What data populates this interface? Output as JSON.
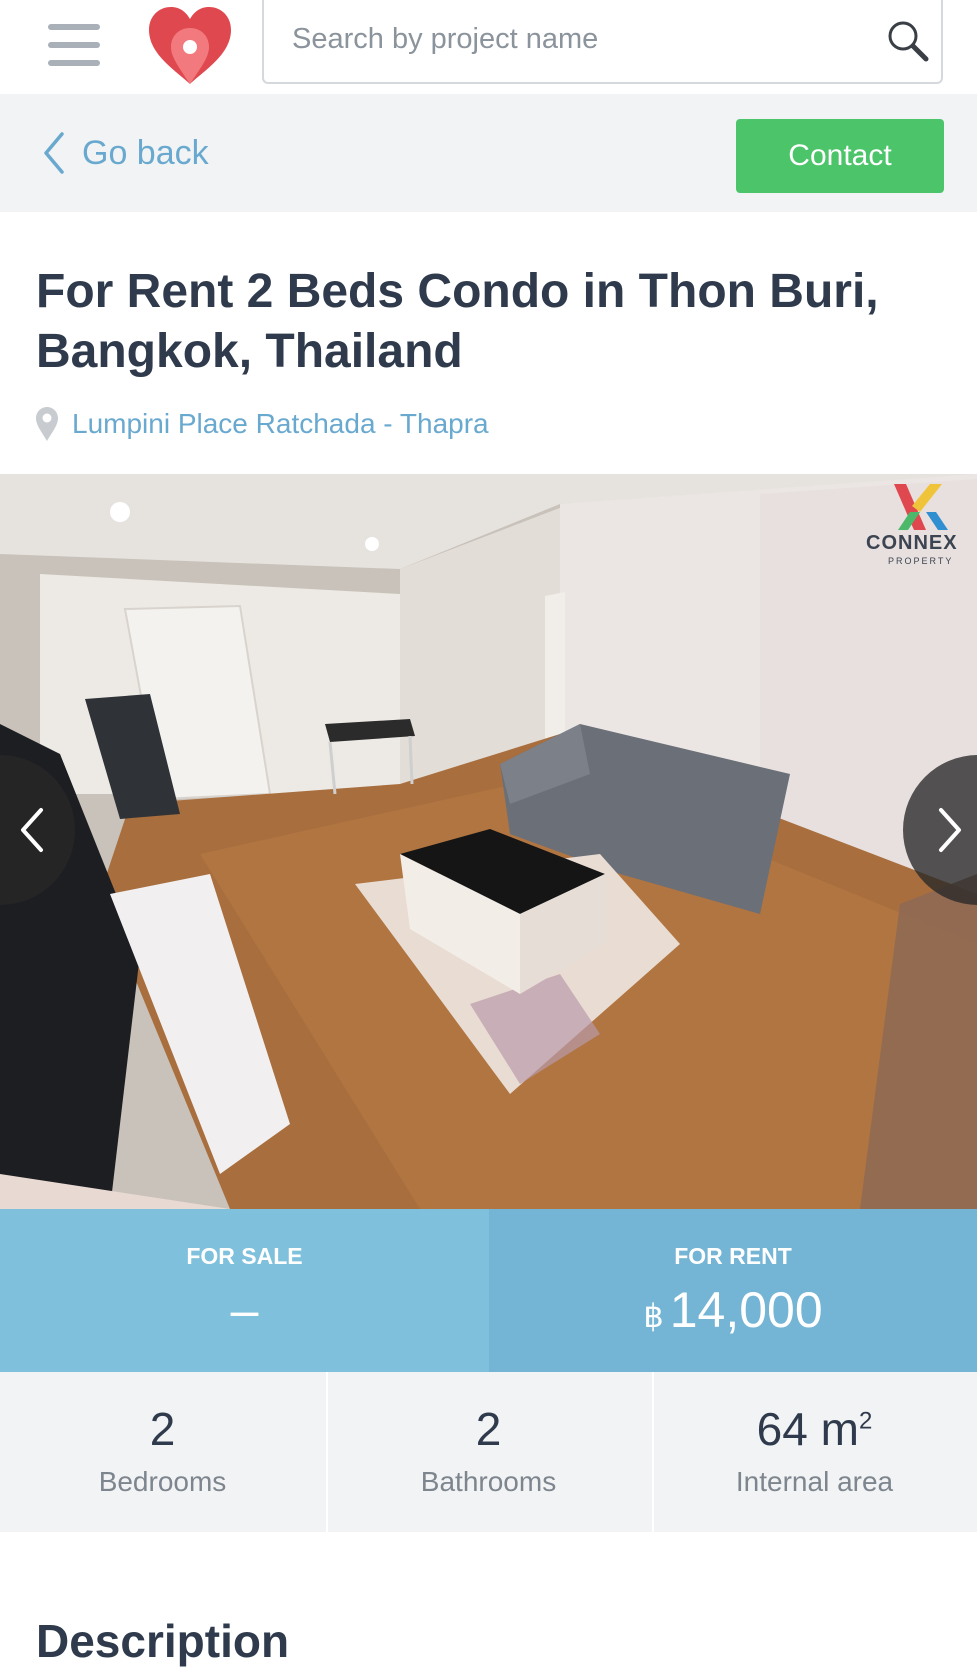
{
  "header": {
    "search_placeholder": "Search by project name",
    "menu_icon": "hamburger-menu-icon",
    "logo_icon": "heart-pin-logo",
    "search_icon": "magnifier-icon"
  },
  "nav": {
    "back_label": "Go back",
    "contact_label": "Contact"
  },
  "listing": {
    "title": "For Rent 2 Beds Condo in Thon Buri, Bangkok, Thailand",
    "location": "Lumpini Place Ratchada - Thapra"
  },
  "gallery": {
    "watermark_name": "CONNEX",
    "watermark_sub": "PROPERTY"
  },
  "prices": {
    "sale_label": "FOR SALE",
    "sale_value": "–",
    "rent_label": "FOR RENT",
    "rent_currency": "฿",
    "rent_value": "14,000"
  },
  "stats": {
    "bedrooms_value": "2",
    "bedrooms_label": "Bedrooms",
    "bathrooms_value": "2",
    "bathrooms_label": "Bathrooms",
    "area_value": "64",
    "area_unit": "m",
    "area_unit_sup": "2",
    "area_label": "Internal area"
  },
  "description": {
    "heading": "Description"
  },
  "colors": {
    "accent_link": "#6aa9cf",
    "contact_green": "#4cc46a",
    "sale_blue": "#7fc0dc",
    "rent_blue": "#74b4d4",
    "logo_red": "#e0484f"
  }
}
